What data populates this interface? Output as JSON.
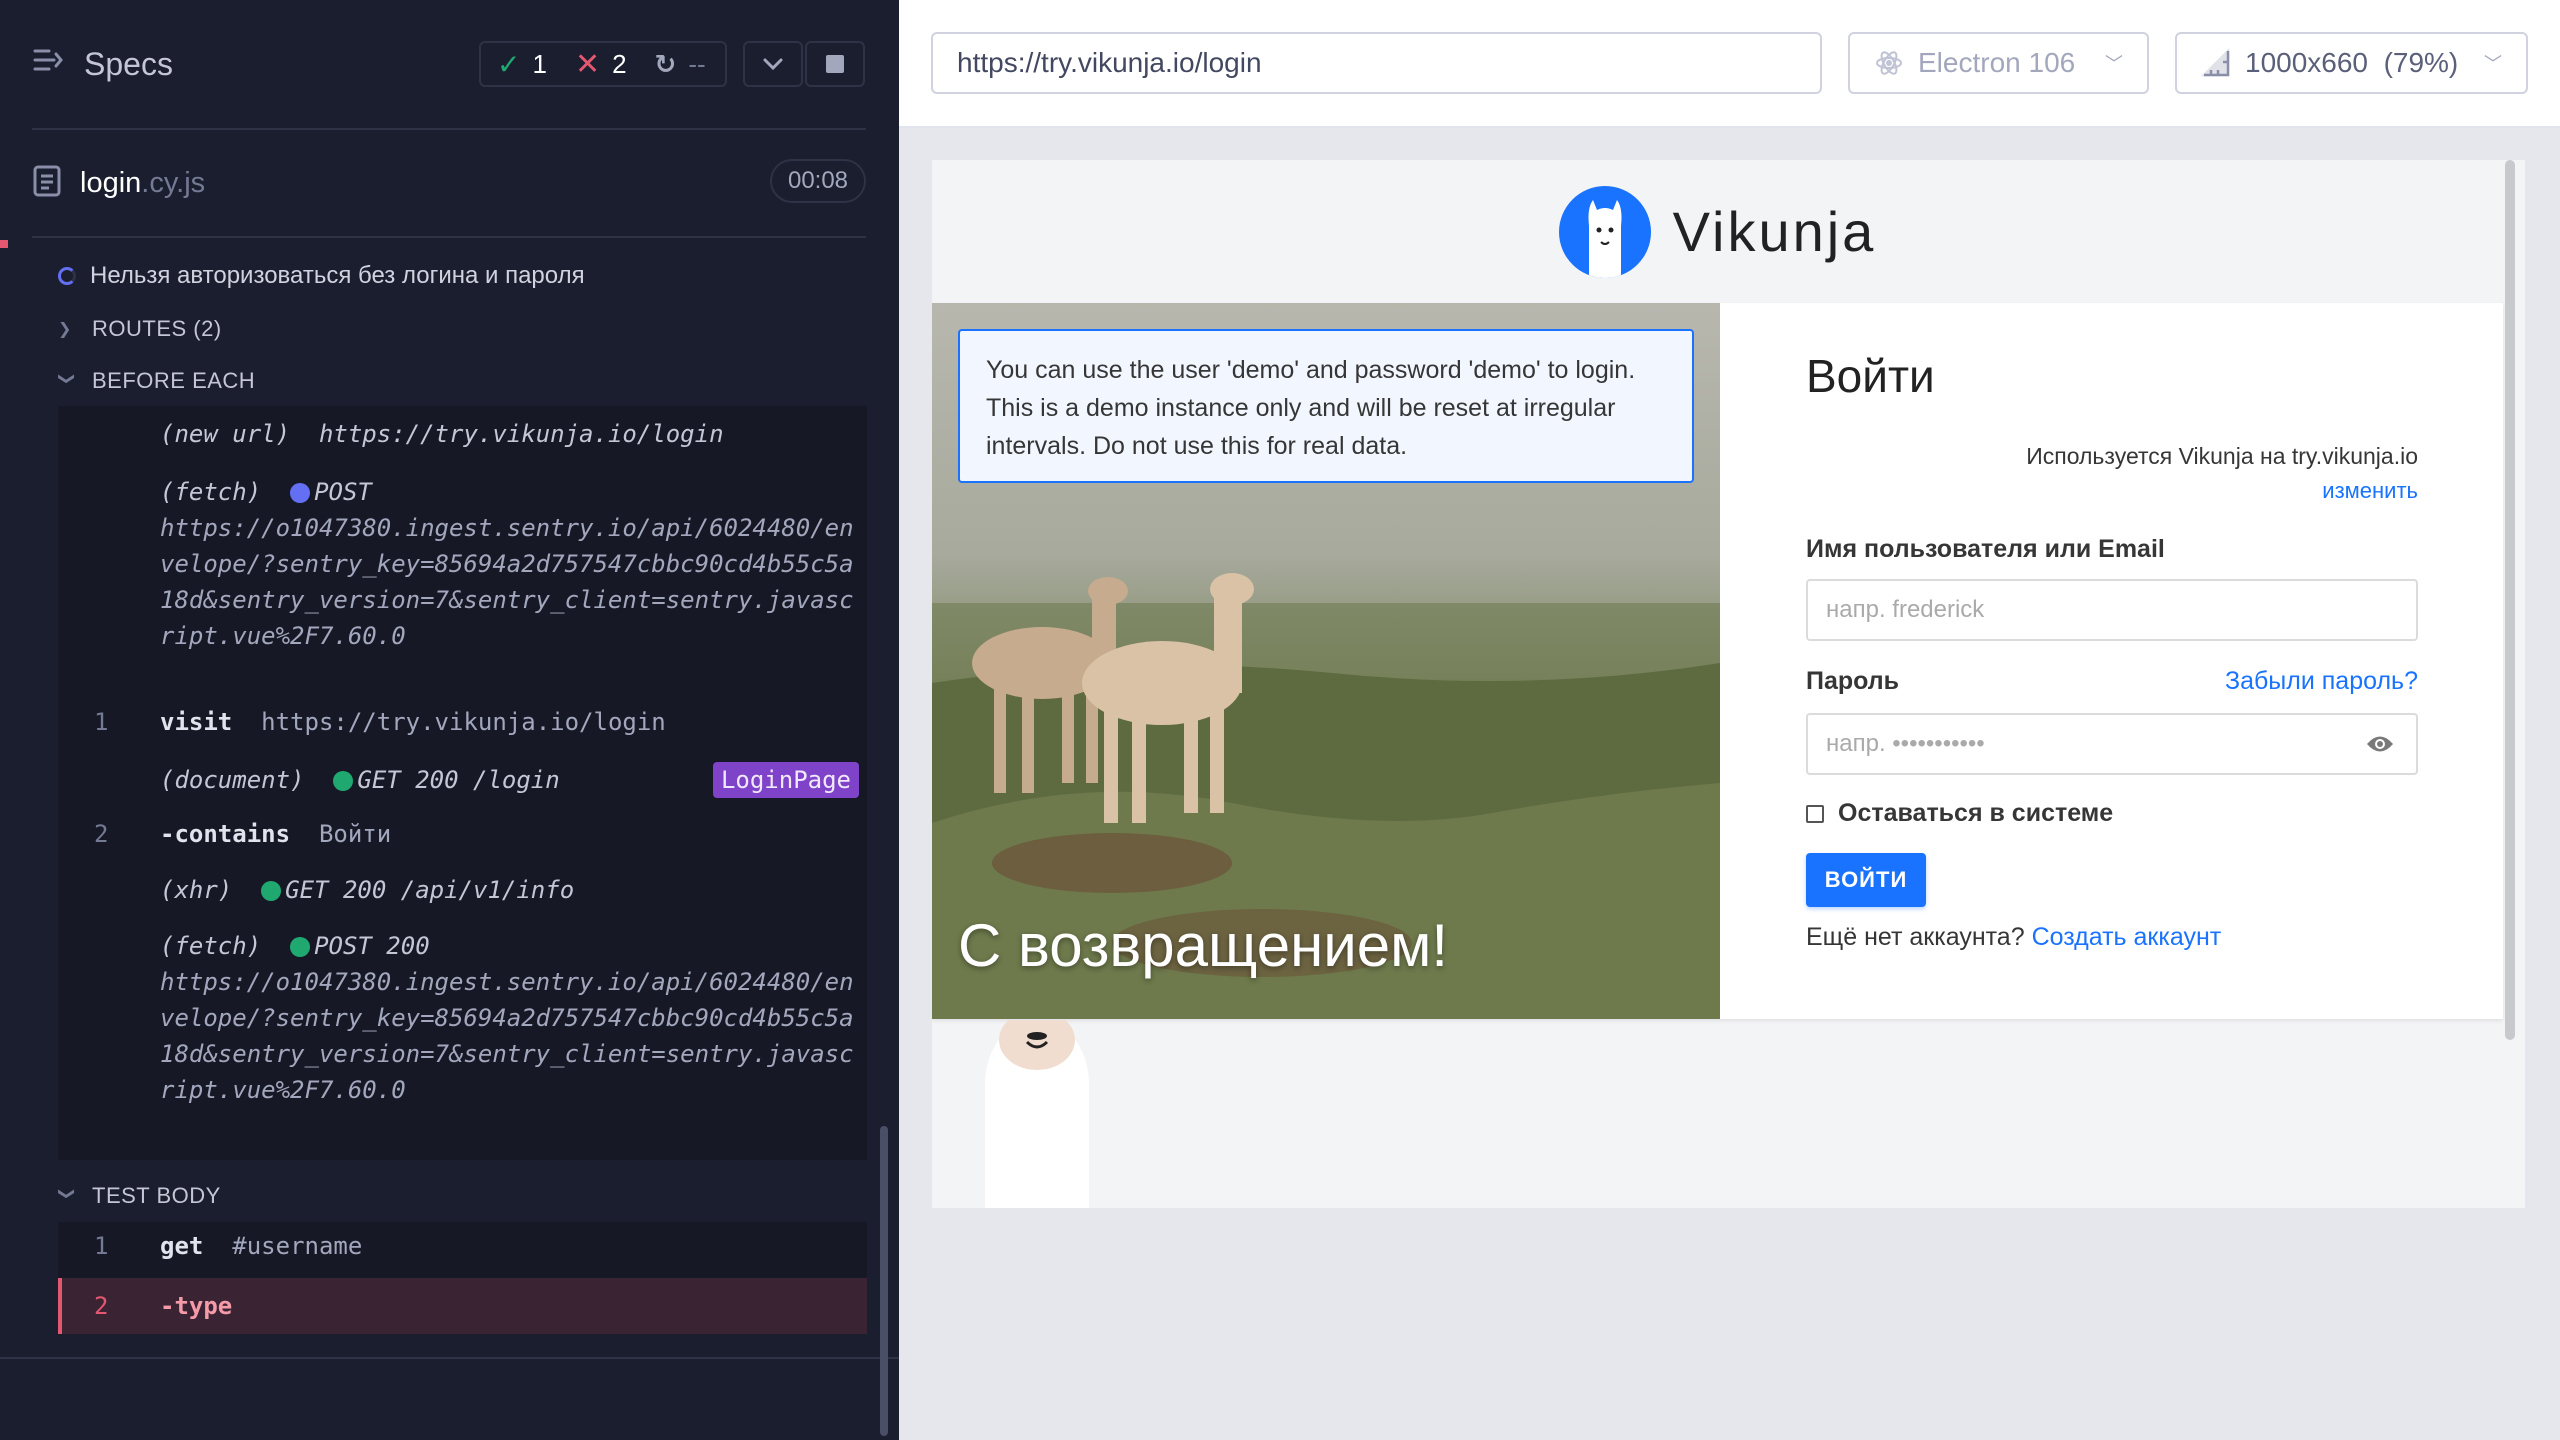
{
  "reporter": {
    "title": "Specs",
    "stats": {
      "passed": "1",
      "failed": "2",
      "pending": "--"
    },
    "file": {
      "name": "login",
      "ext": ".cy.js",
      "duration": "00:08"
    },
    "test_title": "Нельзя авторизоваться без логина и пароля",
    "routes_label": "ROUTES (2)",
    "before_each_label": "BEFORE EACH",
    "test_body_label": "TEST BODY",
    "before_each": [
      {
        "num": "",
        "type": "meta",
        "name": "(new url)",
        "arg": "https://try.vikunja.io/login"
      },
      {
        "num": "",
        "type": "meta-dot",
        "name": "(fetch)",
        "dot": "blue",
        "arg": "POST",
        "wrap": "https://o1047380.ingest.sentry.io/api/6024480/envelope/?sentry_key=85694a2d757547cbbc90cd4b55c5a18d&sentry_version=7&sentry_client=sentry.javascript.vue%2F7.60.0"
      },
      {
        "num": "1",
        "type": "cmd",
        "name": "visit",
        "arg": "https://try.vikunja.io/login"
      },
      {
        "num": "",
        "type": "meta-dot",
        "name": "(document)",
        "dot": "green",
        "arg": "GET 200 /login",
        "badge": "LoginPage"
      },
      {
        "num": "2",
        "type": "cmd",
        "name": "-contains",
        "arg": "Войти"
      },
      {
        "num": "",
        "type": "meta-dot",
        "name": "(xhr)",
        "dot": "green",
        "arg": "GET 200 /api/v1/info"
      },
      {
        "num": "",
        "type": "meta-dot",
        "name": "(fetch)",
        "dot": "green",
        "arg": "POST 200",
        "wrap": "https://o1047380.ingest.sentry.io/api/6024480/envelope/?sentry_key=85694a2d757547cbbc90cd4b55c5a18d&sentry_version=7&sentry_client=sentry.javascript.vue%2F7.60.0"
      }
    ],
    "test_body": [
      {
        "num": "1",
        "name": "get",
        "arg": "#username"
      },
      {
        "num": "2",
        "name": "-type",
        "arg": "",
        "state": "failed"
      }
    ]
  },
  "aut": {
    "url": "https://try.vikunja.io/login",
    "browser": "Electron 106",
    "viewport": "1000x660  (79%)"
  },
  "vikunja": {
    "logo_text": "Vikunja",
    "demo_note": "You can use the user 'demo' and password 'demo' to login. This is a demo instance only and will be reset at irregular intervals. Do not use this for real data.",
    "welcome": "С возвращением!",
    "login_title": "Войти",
    "instance_note": "Используется Vikunja на try.vikunja.io",
    "change_link": "изменить",
    "username_label": "Имя пользователя или Email",
    "username_placeholder": "напр. frederick",
    "password_label": "Пароль",
    "forgot_link": "Забыли пароль?",
    "password_placeholder": "напр. •••••••••••",
    "remember_label": "Оставаться в системе",
    "login_button": "ВОЙТИ",
    "no_account": "Ещё нет аккаунта?",
    "create_account": "Создать аккаунт"
  },
  "colors": {
    "reporter_bg": "#1b1e2e",
    "pass": "#1fa971",
    "fail": "#e45770",
    "accent": "#1973ff",
    "badge": "#7f43c9"
  }
}
